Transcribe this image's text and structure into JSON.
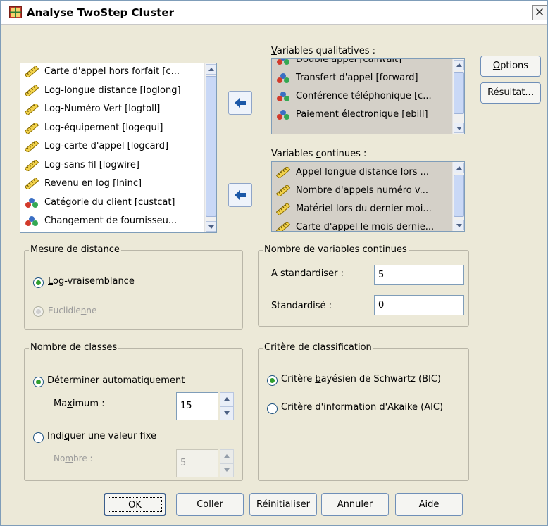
{
  "window": {
    "title": "Analyse TwoStep Cluster",
    "close_glyph": "✕"
  },
  "source_list": {
    "items": [
      {
        "label": "Carte d'appel hors forfait [c...",
        "icon": "scale-ruler-icon"
      },
      {
        "label": "Log-longue distance [loglong]",
        "icon": "scale-ruler-icon"
      },
      {
        "label": "Log-Numéro Vert [logtoll]",
        "icon": "scale-ruler-icon"
      },
      {
        "label": "Log-équipement [logequi]",
        "icon": "scale-ruler-icon"
      },
      {
        "label": "Log-carte d'appel [logcard]",
        "icon": "scale-ruler-icon"
      },
      {
        "label": "Log-sans fil [logwire]",
        "icon": "scale-ruler-icon"
      },
      {
        "label": "Revenu en log [lninc]",
        "icon": "scale-ruler-icon"
      },
      {
        "label": "Catégorie du client [custcat]",
        "icon": "nominal-balls-icon"
      },
      {
        "label": "Changement de fournisseu...",
        "icon": "nominal-balls-icon"
      }
    ]
  },
  "qualitative": {
    "label_pre": "",
    "label_ul": "V",
    "label_post": "ariables qualitatives :",
    "items": [
      {
        "label": "Double appel [callwait]",
        "icon": "nominal-balls-icon"
      },
      {
        "label": "Transfert d'appel [forward]",
        "icon": "nominal-balls-icon"
      },
      {
        "label": "Conférence téléphonique [c...",
        "icon": "nominal-balls-icon"
      },
      {
        "label": "Paiement électronique [ebill]",
        "icon": "nominal-balls-icon"
      }
    ]
  },
  "continuous": {
    "label_pre": "Variables ",
    "label_ul": "c",
    "label_post": "ontinues :",
    "items": [
      {
        "label": "Appel longue distance lors ...",
        "icon": "scale-ruler-icon"
      },
      {
        "label": "Nombre d'appels numéro v...",
        "icon": "scale-ruler-icon"
      },
      {
        "label": "Matériel lors du dernier moi...",
        "icon": "scale-ruler-icon"
      },
      {
        "label": "Carte d'appel le mois dernie...",
        "icon": "scale-ruler-icon"
      }
    ]
  },
  "buttons_side": {
    "options": {
      "pre": "",
      "ul": "O",
      "post": "ptions"
    },
    "results": {
      "pre": "Rés",
      "ul": "u",
      "post": "ltat..."
    }
  },
  "distance": {
    "legend": "Mesure de distance",
    "loglik": {
      "pre": "",
      "ul": "L",
      "post": "og-vraisemblance",
      "selected": true
    },
    "euclid": {
      "pre": "Euclidie",
      "ul": "n",
      "post": "ne",
      "enabled": false
    }
  },
  "cont_count": {
    "legend": "Nombre de variables continues",
    "to_standardize_label": "A standardiser :",
    "to_standardize_value": "5",
    "standardized_label": "Standardisé :",
    "standardized_value": "0"
  },
  "clusters": {
    "legend": "Nombre de classes",
    "auto": {
      "pre": "",
      "ul": "D",
      "post": "éterminer automatiquement",
      "selected": true
    },
    "maximum_label": {
      "pre": "Ma",
      "ul": "x",
      "post": "imum :"
    },
    "maximum_value": "15",
    "fixed": {
      "pre": "Indi",
      "ul": "q",
      "post": "uer une valeur fixe"
    },
    "number_label": {
      "pre": "No",
      "ul": "m",
      "post": "bre :"
    },
    "number_value": "5"
  },
  "criterion": {
    "legend": "Critère de classification",
    "bic": {
      "pre": "Critère ",
      "ul": "b",
      "post": "ayésien de Schwartz (BIC)",
      "selected": true
    },
    "aic": {
      "pre": "Critère d'infor",
      "ul": "m",
      "post": "ation d'Akaike (AIC)"
    }
  },
  "bottom": {
    "ok": "OK",
    "paste": "Coller",
    "reset": {
      "pre": "",
      "ul": "R",
      "post": "éinitialiser"
    },
    "cancel": "Annuler",
    "help": "Aide"
  },
  "colors": {
    "dialog_bg": "#ece9d8",
    "list_border": "#7f9db9",
    "radio_selected": "#2f9e2f"
  }
}
